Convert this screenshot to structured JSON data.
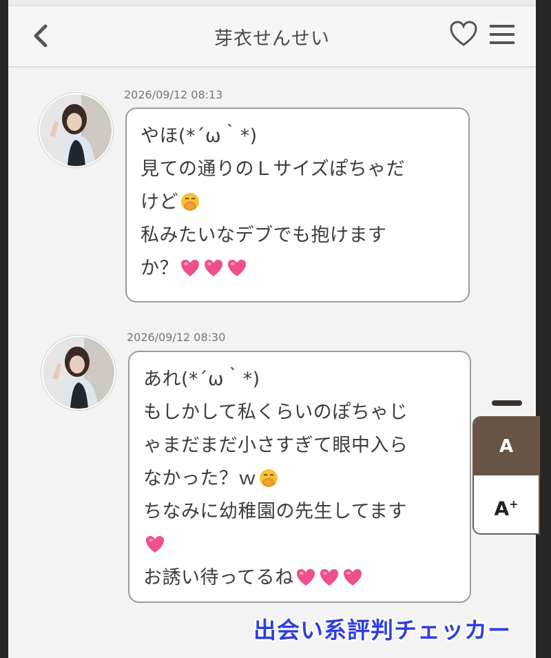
{
  "header": {
    "title": "芽衣せんせい"
  },
  "messages": [
    {
      "timestamp": "2026/09/12 08:13",
      "lines": [
        [
          "やほ(*´ω｀*)"
        ],
        [
          "見ての通りのＬサイズぽちゃだ"
        ],
        [
          "けど",
          "emoji:hand-over-mouth"
        ],
        [
          "私みたいなデブでも抱けます"
        ],
        [
          "か？",
          "emoji:heart",
          "emoji:heart",
          "emoji:heart"
        ]
      ]
    },
    {
      "timestamp": "2026/09/12 08:30",
      "lines": [
        [
          "あれ(*´ω｀*)"
        ],
        [
          "もしかして私くらいのぽちゃじ"
        ],
        [
          "ゃまだまだ小さすぎて眼中入ら"
        ],
        [
          "なかった？ｗ",
          "emoji:hand-over-mouth"
        ],
        [
          "ちなみに幼稚園の先生してます"
        ],
        [
          "emoji:heart"
        ],
        [
          "お誘い待ってるね",
          "emoji:heart",
          "emoji:heart",
          "emoji:heart"
        ]
      ]
    }
  ],
  "font_size_panel": {
    "small_label": "A",
    "large_label": "A",
    "large_sup": "+"
  },
  "watermark": "出会い系評判チェッカー",
  "colors": {
    "accent_brown": "#675445",
    "heart_pink": "#ef4f8c",
    "watermark_blue": "#2f3fe0"
  }
}
